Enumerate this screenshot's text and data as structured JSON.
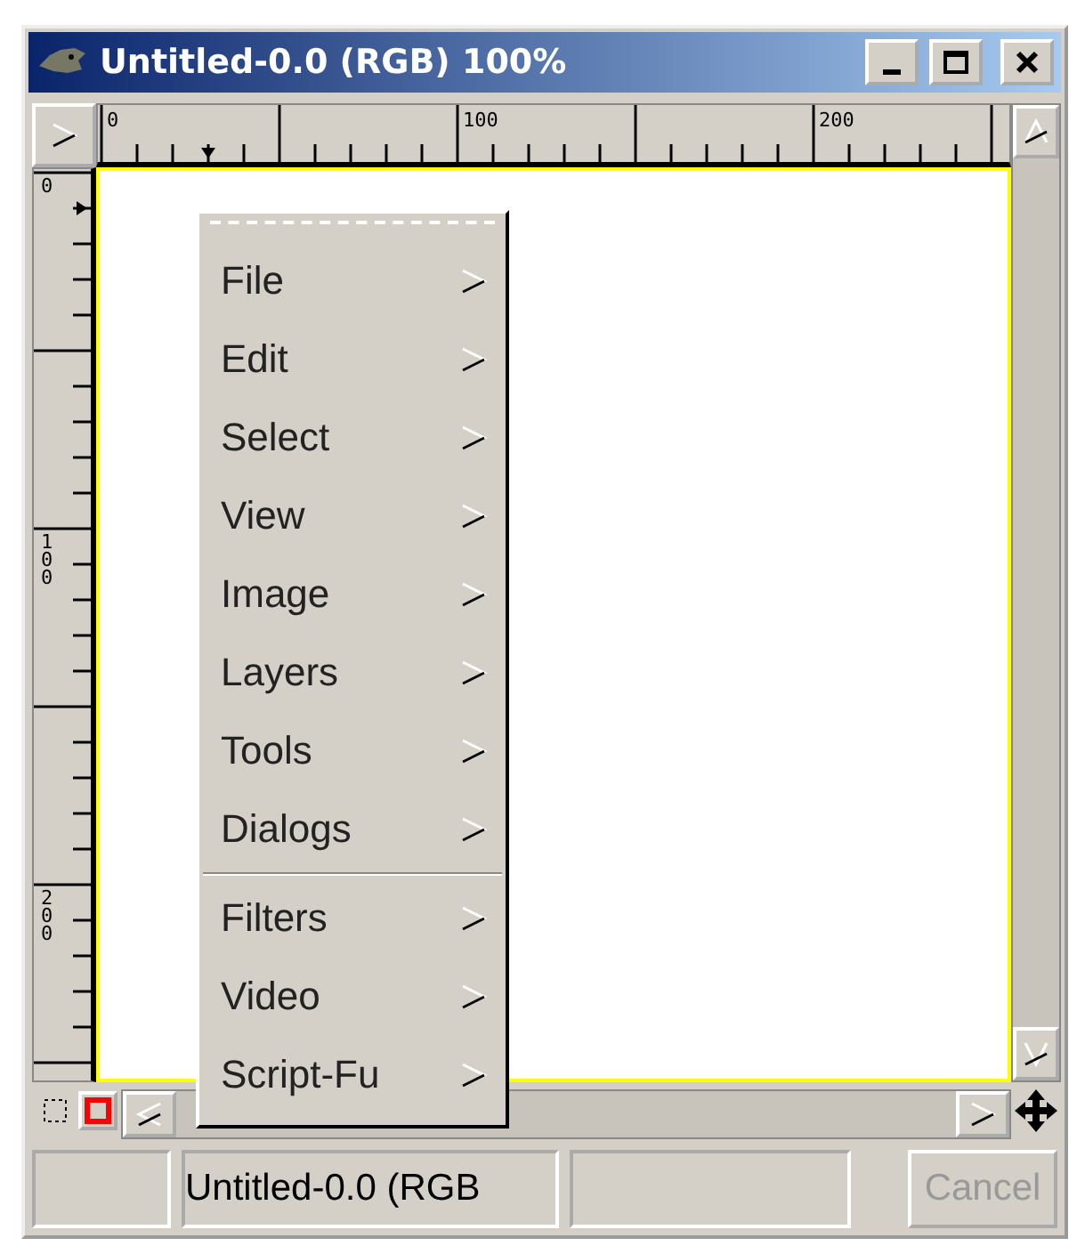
{
  "window": {
    "title": "Untitled-0.0 (RGB) 100%"
  },
  "rulers": {
    "horizontal": [
      "0",
      "100",
      "200"
    ],
    "vertical": [
      "0",
      "100",
      "200"
    ]
  },
  "menu": {
    "groups": [
      [
        "File",
        "Edit",
        "Select",
        "View",
        "Image",
        "Layers",
        "Tools",
        "Dialogs"
      ],
      [
        "Filters",
        "Video",
        "Script-Fu"
      ]
    ]
  },
  "status_bar": {
    "document": "Untitled-0.0 (RGB",
    "cancel": {
      "label": "Cancel",
      "disabled": true
    }
  }
}
